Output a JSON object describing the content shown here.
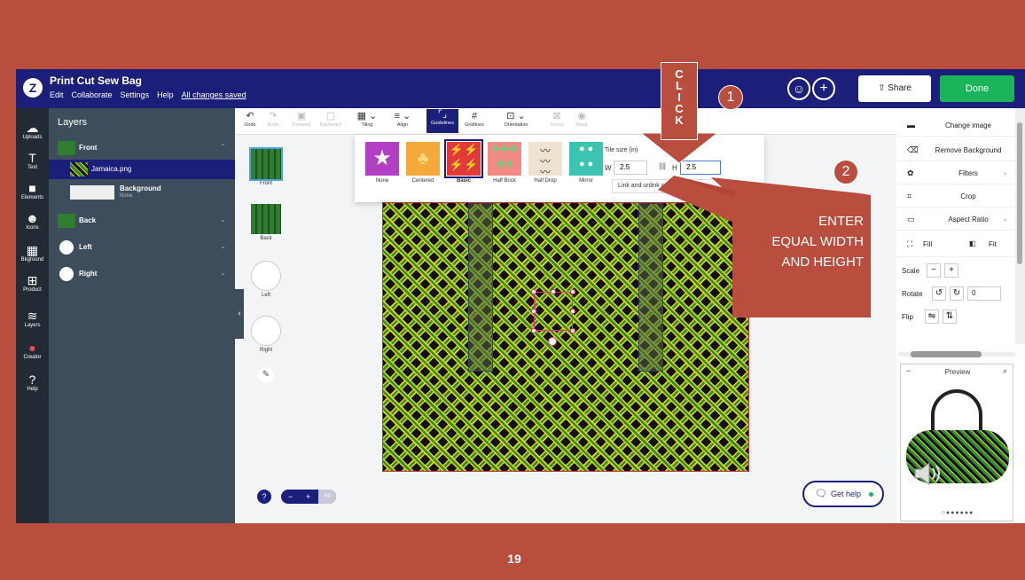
{
  "app": {
    "title": "Print Cut Sew Bag",
    "logo": "Z",
    "menu": [
      "Edit",
      "Collaborate",
      "Settings",
      "Help"
    ],
    "saved_status": "All changes saved",
    "share_label": "Share",
    "done_label": "Done"
  },
  "rail": [
    "Uploads",
    "Text",
    "Elements",
    "Icons",
    "Bkground",
    "Product",
    "Layers",
    "Creator",
    "Help"
  ],
  "layers": {
    "title": "Layers",
    "items": [
      {
        "name": "Front",
        "expanded": true
      },
      {
        "name": "Jamaica.png",
        "selected": true
      },
      {
        "name": "Background",
        "sub": "None"
      },
      {
        "name": "Back"
      },
      {
        "name": "Left"
      },
      {
        "name": "Right"
      }
    ]
  },
  "toolbar": {
    "items": [
      "Undo",
      "Redo",
      "Forward",
      "Backward",
      "Tiling",
      "Align",
      "Guidelines",
      "Gridlines",
      "Orientation",
      "Group",
      "Mask"
    ]
  },
  "sides": [
    "Front",
    "Back",
    "Left",
    "Right"
  ],
  "tiling": {
    "options": [
      "None",
      "Centered",
      "Basic",
      "Half Brick",
      "Half Drop",
      "Mirror"
    ],
    "selected": "Basic",
    "size_label": "Tile size (in)",
    "w_label": "W",
    "w_value": "2.5",
    "h_label": "H",
    "h_value": "2.5",
    "link_tooltip": "Link and unlink custom size"
  },
  "zoom": {
    "help": "?",
    "minus": "−",
    "plus": "+",
    "fit": "Fit"
  },
  "get_help": "Get help",
  "props": {
    "items": [
      "Change image",
      "Remove Background",
      "Filters",
      "Crop",
      "Aspect Ratio"
    ],
    "fill_label": "Fill",
    "fit_label": "Fit",
    "scale_label": "Scale",
    "rotate_label": "Rotate",
    "rotate_value": "0",
    "flip_label": "Flip",
    "preview_title": "Preview"
  },
  "annotations": {
    "click_letters": [
      "C",
      "L",
      "I",
      "C",
      "K"
    ],
    "badge1": "1",
    "badge2": "2",
    "callout_lines": [
      "ENTER",
      "EQUAL WIDTH",
      "AND HEIGHT"
    ],
    "page_number": "19",
    "accent": "#b94d3e"
  },
  "colors": {
    "brand_navy": "#1b1f7a",
    "done_green": "#1bb45a",
    "slide_bg": "#b94d3e"
  }
}
